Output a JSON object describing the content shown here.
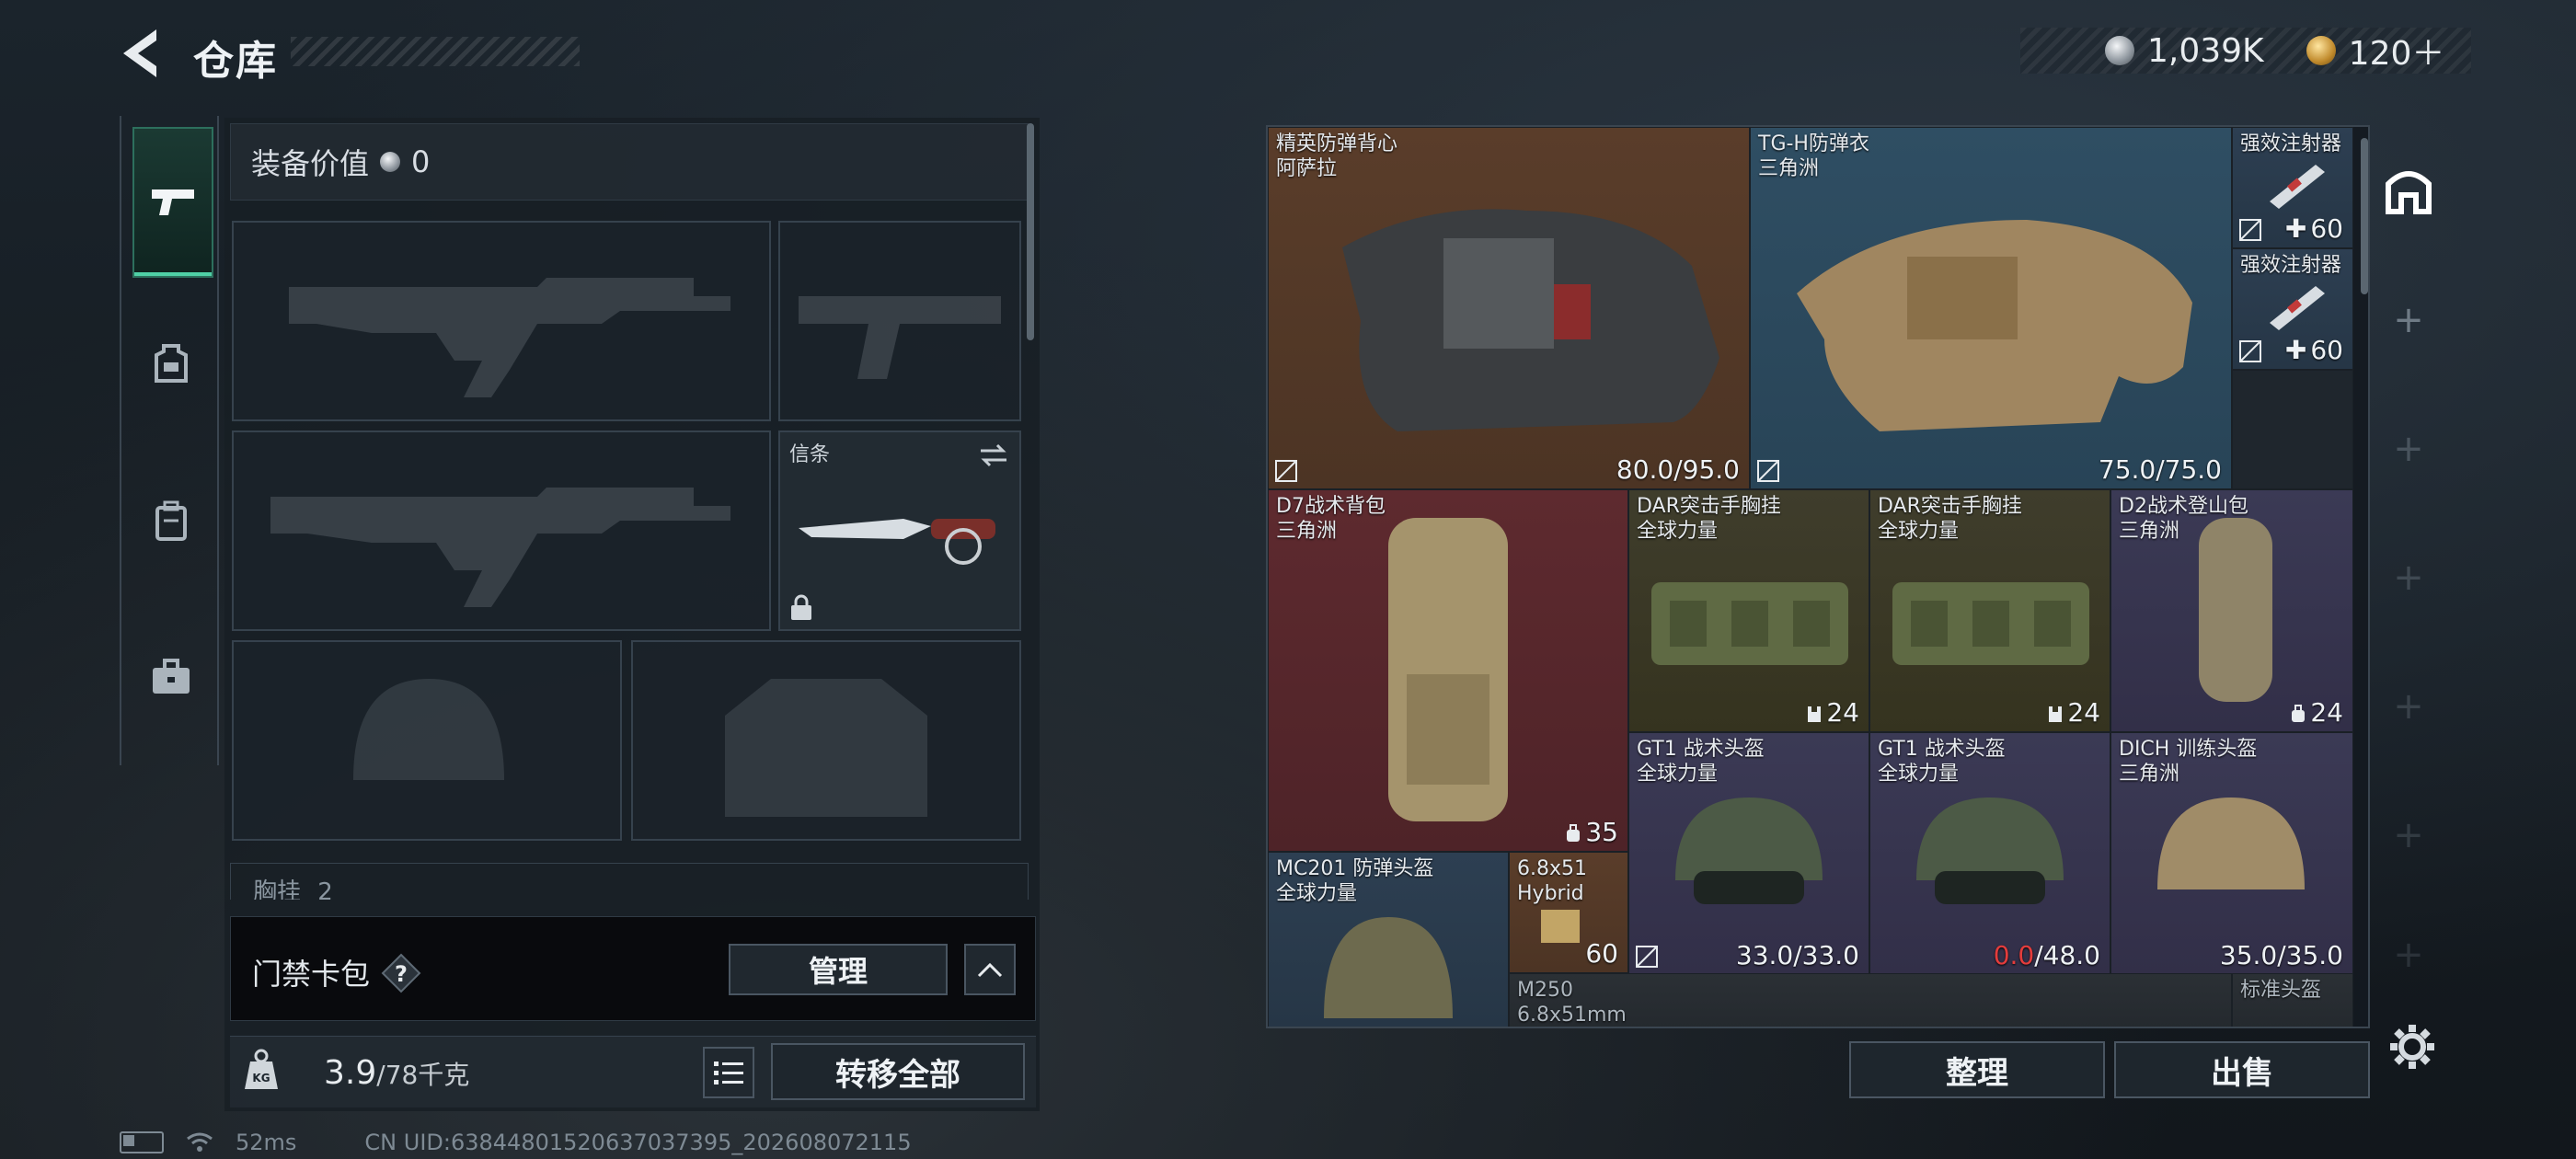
{
  "header": {
    "title": "仓库"
  },
  "currency": {
    "silver": "1,039K",
    "premium": "120＋"
  },
  "loadout": {
    "equip_value_label": "装备价值",
    "equip_value": "0",
    "melee_slot_label": "信条",
    "chest_rig_label": "胸挂",
    "chest_rig_count": "2",
    "keycard_label": "门禁卡包",
    "manage_label": "管理",
    "weight_value": "3.9",
    "weight_max": "/78千克",
    "transfer_all_label": "转移全部"
  },
  "warehouse": {
    "items": [
      {
        "name": "精英防弹背心",
        "sub": "阿萨拉",
        "value": "80.0/95.0",
        "rarity": "brown"
      },
      {
        "name": "TG-H防弹衣",
        "sub": "三角洲",
        "value": "75.0/75.0",
        "rarity": "blue"
      },
      {
        "name": "强效注射器",
        "sub": "",
        "value": "60",
        "rarity": "slate"
      },
      {
        "name": "强效注射器",
        "sub": "",
        "value": "60",
        "rarity": "slate"
      },
      {
        "name": "D7战术背包",
        "sub": "三角洲",
        "value": "35",
        "rarity": "red"
      },
      {
        "name": "DAR突击手胸挂",
        "sub": "全球力量",
        "value": "24",
        "rarity": "olive"
      },
      {
        "name": "DAR突击手胸挂",
        "sub": "全球力量",
        "value": "24",
        "rarity": "olive"
      },
      {
        "name": "D2战术登山包",
        "sub": "三角洲",
        "value": "24",
        "rarity": "purple"
      },
      {
        "name": "GT1 战术头盔",
        "sub": "全球力量",
        "value": "33.0/33.0",
        "rarity": "purple"
      },
      {
        "name": "GT1 战术头盔",
        "sub": "全球力量",
        "value_red": "0.0",
        "value_max": "/48.0",
        "rarity": "purple"
      },
      {
        "name": "DICH 训练头盔",
        "sub": "三角洲",
        "value": "35.0/35.0",
        "rarity": "purple"
      },
      {
        "name": "MC201 防弹头盔",
        "sub": "全球力量",
        "rarity": "slate"
      },
      {
        "name": "6.8x51",
        "sub": "Hybrid",
        "value": "60",
        "rarity": "brown"
      },
      {
        "name": "M250",
        "sub": "6.8x51mm",
        "rarity": "dark"
      },
      {
        "name": "标准头盔",
        "sub": "",
        "rarity": "dark"
      }
    ],
    "sort_label": "整理",
    "sell_label": "出售"
  },
  "status": {
    "ping": "52ms",
    "uid": "CN UID:6384480152063703​7395_202608072115"
  },
  "icons": {
    "back": "back-arrow-icon",
    "weapons_tab": "pistol-icon",
    "armor_tab": "armor-icon",
    "backpack_tab": "backpack-icon",
    "case_tab": "briefcase-icon",
    "stash_rail": "stash-icon",
    "settings": "gear-icon"
  },
  "colors": {
    "accent": "#4fd0a6",
    "alert": "#e43c3c"
  }
}
